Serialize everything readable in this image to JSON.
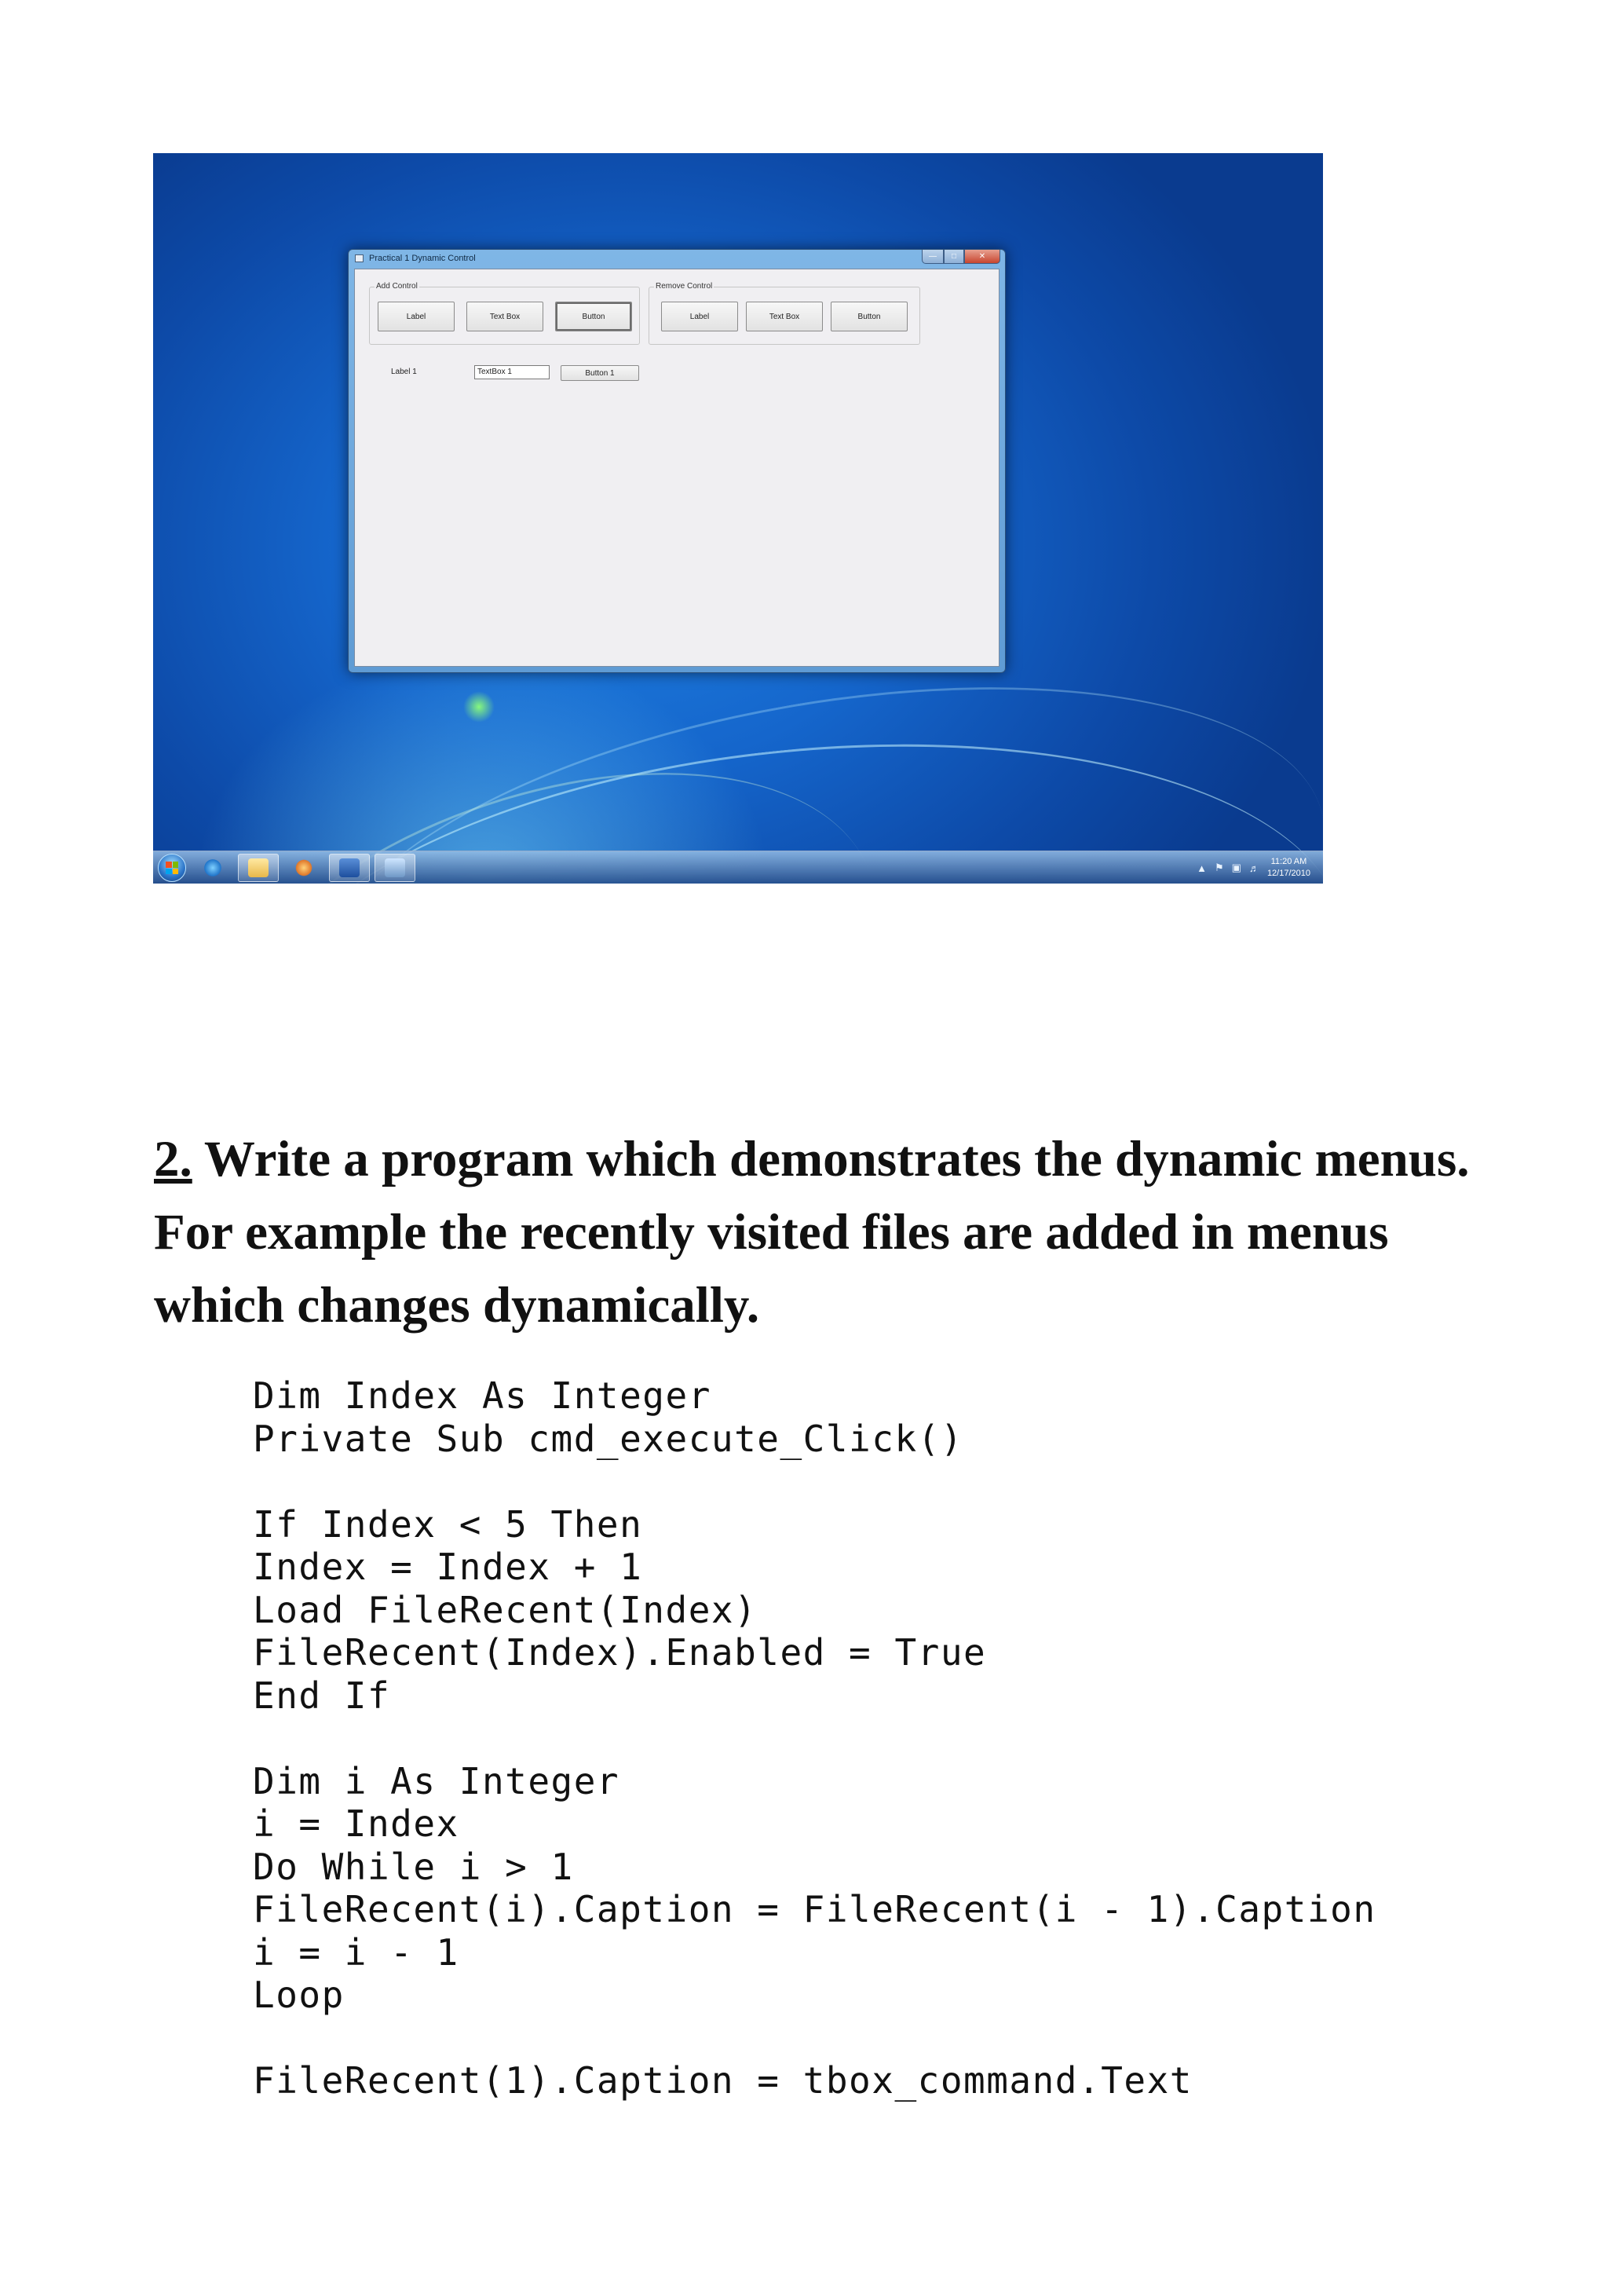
{
  "screenshot": {
    "window": {
      "title": "Practical 1 Dynamic Control",
      "add_group": {
        "legend": "Add Control",
        "buttons": [
          "Label",
          "Text Box",
          "Button"
        ]
      },
      "remove_group": {
        "legend": "Remove Control",
        "buttons": [
          "Label",
          "Text Box",
          "Button"
        ]
      },
      "dynamic_controls": {
        "label": "Label 1",
        "textbox_value": "TextBox 1",
        "button": "Button 1"
      }
    },
    "taskbar": {
      "items": [
        "start-orb",
        "internet-explorer-icon",
        "windows-explorer-icon",
        "media-player-icon",
        "word-icon",
        "vb6-app-icon"
      ],
      "clock_time": "11:20 AM",
      "clock_date": "12/17/2010"
    },
    "colors": {
      "desktop": "#1566cc",
      "window_frame": "#6fa8dd",
      "client": "#f0eff2"
    }
  },
  "question": {
    "number": "2.",
    "text": " Write a program which demonstrates the dynamic menus. For example the recently visited files are added in menus which changes dynamically."
  },
  "code_lines": [
    "Dim Index As Integer",
    "Private Sub cmd_execute_Click()",
    "",
    "If Index < 5 Then",
    "Index = Index + 1",
    "Load FileRecent(Index)",
    "FileRecent(Index).Enabled = True",
    "End If",
    "",
    "Dim i As Integer",
    "i = Index",
    "Do While i > 1",
    "FileRecent(i).Caption = FileRecent(i - 1).Caption",
    "i = i - 1",
    "Loop",
    "",
    "FileRecent(1).Caption = tbox_command.Text"
  ]
}
